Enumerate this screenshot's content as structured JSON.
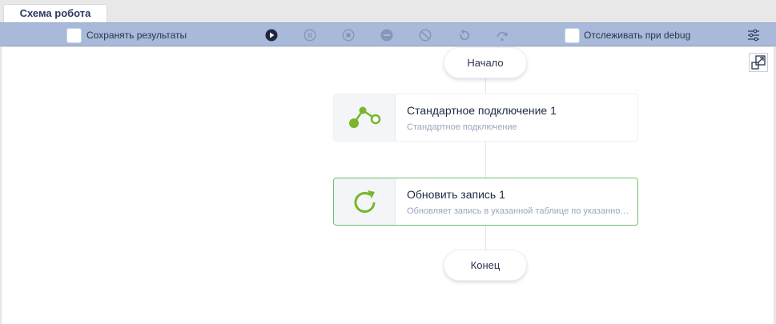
{
  "tab": {
    "label": "Схема робота"
  },
  "toolbar": {
    "save_results_label": "Сохранять результаты",
    "debug_track_label": "Отслеживать при debug",
    "icons": [
      "play-icon",
      "pause-icon",
      "stop-icon",
      "minus-circle-icon",
      "cancel-icon",
      "undo-icon",
      "redo-icon",
      "settings-sliders-icon"
    ]
  },
  "flow": {
    "start_label": "Начало",
    "end_label": "Конец",
    "nodes": [
      {
        "title": "Стандартное подключение  1",
        "subtitle": "Стандартное подключение",
        "icon": "connection-icon"
      },
      {
        "title": "Обновить запись  1",
        "subtitle": "Обновляет запись в указанной таблице по указанному условию",
        "icon": "refresh-icon"
      }
    ]
  },
  "colors": {
    "accent_green": "#7ab52a",
    "selected_border": "#6cc16a",
    "toolbar_bg": "#a8b9d9"
  }
}
